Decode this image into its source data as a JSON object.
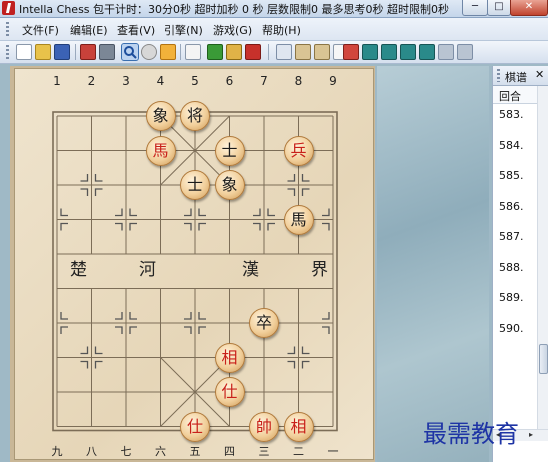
{
  "window": {
    "title": "Intella Chess 包干计时：30分0秒 超时加秒 0 秒 层数限制0 最多思考0秒 超时限制0秒",
    "buttons": {
      "minimize": "─",
      "maximize": "□",
      "close": "✕"
    }
  },
  "menu": [
    "文件(F)",
    "编辑(E)",
    "查看(V)",
    "引擎(N)",
    "游戏(G)",
    "帮助(H)"
  ],
  "toolbar": {
    "icons": [
      "new-icon",
      "open-icon",
      "save-icon",
      "print-icon",
      "printer-preview-icon",
      "search-icon",
      "stop-icon",
      "refresh-icon",
      "edit-icon",
      "engine-icon",
      "lock-icon",
      "hint-icon",
      "copy-icon",
      "paste-icon",
      "paste-board-icon",
      "comment-icon",
      "first-move-icon",
      "prev-branch-icon",
      "prev-move-icon",
      "next-move-icon",
      "next-branch-icon",
      "last-move-icon"
    ],
    "selected": "search-icon"
  },
  "board": {
    "top_numbers": [
      "1",
      "2",
      "3",
      "4",
      "5",
      "6",
      "7",
      "8",
      "9"
    ],
    "bottom_numbers": [
      "九",
      "八",
      "七",
      "六",
      "五",
      "四",
      "三",
      "二",
      "一"
    ],
    "river": [
      "楚",
      "河",
      "漢",
      "界"
    ],
    "pieces": [
      {
        "char": "象",
        "color": "black",
        "col": 3,
        "row": 0
      },
      {
        "char": "将",
        "color": "black",
        "col": 4,
        "row": 0
      },
      {
        "char": "馬",
        "color": "red",
        "col": 3,
        "row": 1
      },
      {
        "char": "士",
        "color": "black",
        "col": 5,
        "row": 1
      },
      {
        "char": "兵",
        "color": "red",
        "col": 7,
        "row": 1
      },
      {
        "char": "士",
        "color": "black",
        "col": 4,
        "row": 2
      },
      {
        "char": "象",
        "color": "black",
        "col": 5,
        "row": 2
      },
      {
        "char": "馬",
        "color": "black",
        "col": 7,
        "row": 3
      },
      {
        "char": "卒",
        "color": "black",
        "col": 6,
        "row": 6
      },
      {
        "char": "相",
        "color": "red",
        "col": 5,
        "row": 7
      },
      {
        "char": "仕",
        "color": "red",
        "col": 5,
        "row": 8
      },
      {
        "char": "仕",
        "color": "red",
        "col": 4,
        "row": 9
      },
      {
        "char": "帥",
        "color": "red",
        "col": 6,
        "row": 9
      },
      {
        "char": "相",
        "color": "red",
        "col": 7,
        "row": 9
      }
    ]
  },
  "side_panel": {
    "title": "棋谱",
    "close": "✕",
    "column_header": "回合",
    "moves": [
      "583.",
      "584.",
      "585.",
      "586.",
      "587.",
      "588.",
      "589.",
      "590."
    ]
  },
  "watermark": "最需教育"
}
